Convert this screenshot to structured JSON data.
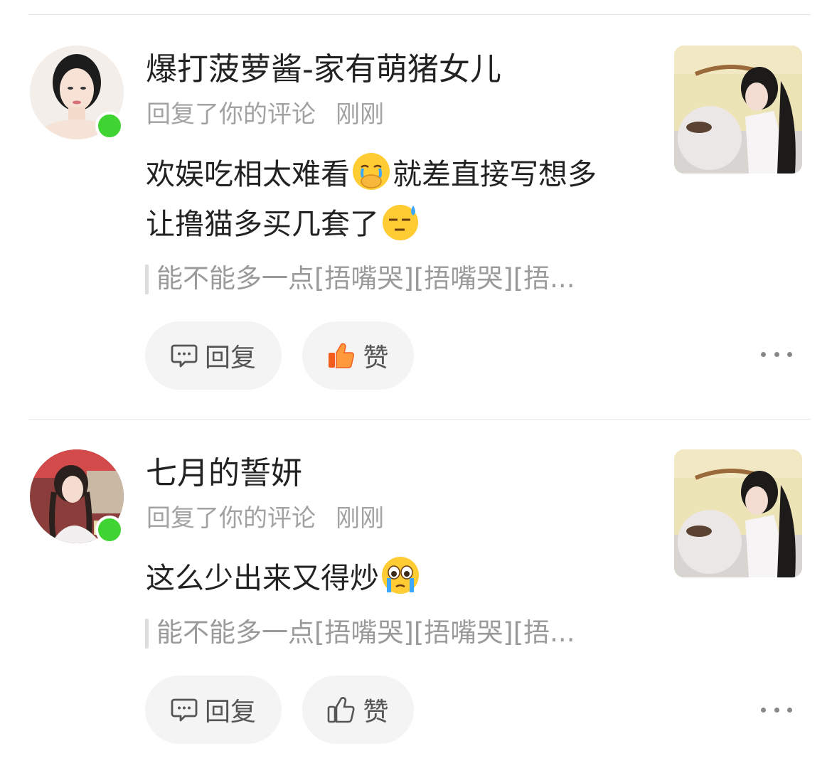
{
  "comments": [
    {
      "username": "爆打菠萝酱-家有萌猪女儿",
      "action": "回复了你的评论",
      "time": "刚刚",
      "text_line1": "欢娱吃相太难看",
      "text_mid": "就差直接写想多",
      "text_line2": "让撸猫多买几套了",
      "emoji1": "cover-mouth-crying-emoji",
      "emoji2": "sweat-face-emoji",
      "quote": "能不能多一点[捂嘴哭][捂嘴哭][捂...",
      "reply_label": "回复",
      "like_label": "赞",
      "liked": true,
      "online": true
    },
    {
      "username": "七月的誓妍",
      "action": "回复了你的评论",
      "time": "刚刚",
      "text_line1": "这么少出来又得炒",
      "emoji1": "teary-eyed-emoji",
      "quote": "能不能多一点[捂嘴哭][捂嘴哭][捂...",
      "reply_label": "回复",
      "like_label": "赞",
      "liked": false,
      "online": true
    }
  ],
  "colors": {
    "online": "#3fd431",
    "like_active": "#f45d1e",
    "meta": "#a2a2a2"
  }
}
